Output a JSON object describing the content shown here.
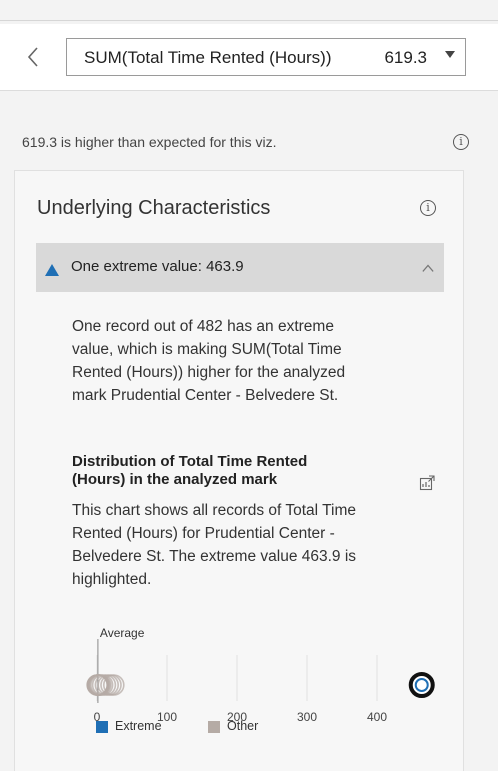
{
  "header": {
    "back_icon": "chevron-left-icon",
    "measure_label": "SUM(Total Time Rented (Hours))",
    "measure_value": "619.3",
    "caret_icon": "caret-down-icon"
  },
  "summary": {
    "text": "619.3 is higher than expected for this viz.",
    "info_icon": "info-icon"
  },
  "card": {
    "title": "Underlying Characteristics",
    "info_icon": "info-icon",
    "accordion": {
      "label": "One extreme value: 463.9",
      "expanded": true,
      "indicator_color": "#1f6fb5"
    },
    "description_lines": [
      "One record out of 482 has an extreme",
      "value, which is making SUM(Total Time",
      "Rented (Hours)) higher for the analyzed",
      "mark Prudential Center - Belvedere St."
    ],
    "distribution": {
      "title_lines": [
        "Distribution of Total Time Rented",
        "(Hours) in the analyzed mark"
      ],
      "open_icon": "open-in-new-icon",
      "description_lines": [
        "This chart shows all records of Total Time",
        "Rented (Hours) for Prudential Center -",
        "Belvedere St. The extreme value 463.9 is",
        "highlighted."
      ]
    }
  },
  "chart_data": {
    "type": "scatter",
    "title": "",
    "xlabel": "",
    "ylabel": "",
    "xlim": [
      0,
      500
    ],
    "x_ticks": [
      0,
      100,
      200,
      300,
      400
    ],
    "x_tick_labels": [
      "0",
      "100",
      "200",
      "300",
      "400"
    ],
    "reference_line": {
      "label": "Average",
      "x": 1.3
    },
    "series": [
      {
        "name": "Extreme",
        "color": "#1f6fb5",
        "values": [
          463.9
        ]
      },
      {
        "name": "Other",
        "color": "#b5aba5",
        "values": [
          0.2,
          0.5,
          0.8,
          1.0,
          1.3,
          1.6,
          2.0,
          2.5,
          3.0,
          4.0,
          5.5,
          8.0,
          12.0,
          16.0,
          20.0,
          24.0
        ]
      }
    ],
    "extreme_highlight_color": "#111111",
    "legend": {
      "position": "bottom",
      "entries": [
        "Extreme",
        "Other"
      ]
    },
    "grid": true
  }
}
